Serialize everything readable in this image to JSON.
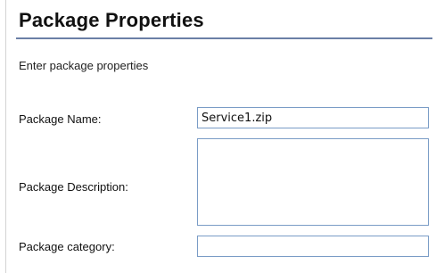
{
  "header": {
    "title": "Package Properties"
  },
  "form": {
    "subtitle": "Enter package properties",
    "name": {
      "label": "Package Name:",
      "value": "Service1.zip"
    },
    "description": {
      "label": "Package Description:",
      "value": ""
    },
    "category": {
      "label": "Package category:",
      "value": ""
    }
  },
  "colors": {
    "header_rule": "#6b7fa6",
    "field_border": "#7a9cc6"
  }
}
